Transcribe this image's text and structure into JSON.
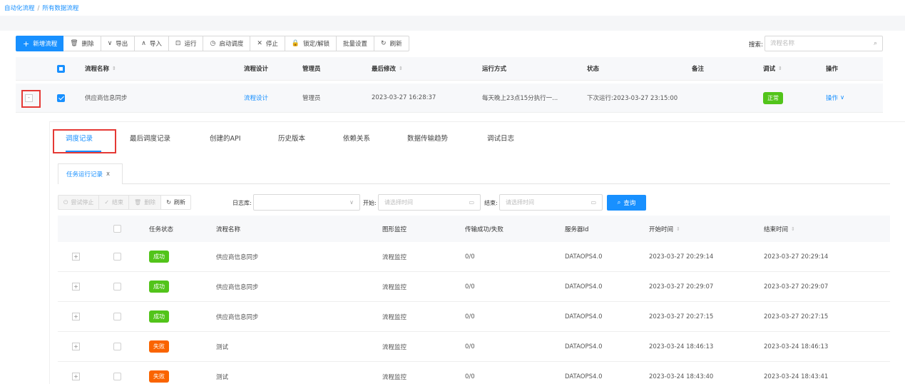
{
  "breadcrumb": {
    "root": "自动化流程",
    "separator": "/",
    "current": "所有数据流程"
  },
  "toolbar": {
    "new_flow": "新增流程",
    "delete": "删除",
    "export": "导出",
    "import": "导入",
    "run": "运行",
    "start_schedule": "启动调度",
    "stop": "停止",
    "lock_unlock": "锁定/解锁",
    "batch_settings": "批量设置",
    "refresh": "刷新"
  },
  "search": {
    "label": "搜索:",
    "placeholder": "流程名称"
  },
  "flow_table": {
    "headers": {
      "name": "流程名称",
      "design": "流程设计",
      "admin": "管理员",
      "last_modified": "最后修改",
      "run_mode": "运行方式",
      "status": "状态",
      "note": "备注",
      "debug": "调试",
      "action": "操作"
    },
    "row": {
      "name": "供应商信息同步",
      "design": "流程设计",
      "admin": "管理员",
      "last_modified": "2023-03-27 16:28:37",
      "run_mode": "每天晚上23点15分执行一...",
      "status": "下次运行:2023-03-27 23:15:00",
      "debug": "正常",
      "action": "操作"
    }
  },
  "detail_tabs": [
    "调度记录",
    "最后调度记录",
    "创建的API",
    "历史版本",
    "依赖关系",
    "数据传输趋势",
    "调试日志"
  ],
  "subtab": {
    "label": "任务运行记录",
    "close": "x"
  },
  "sub_toolbar": {
    "try_stop": "尝试停止",
    "finish": "结束",
    "delete": "删除",
    "refresh": "刷新"
  },
  "filters": {
    "log_label": "日志库:",
    "start_label": "开始:",
    "start_placeholder": "请选择时间",
    "end_label": "结束:",
    "end_placeholder": "请选择时间",
    "query": "查询"
  },
  "task_table": {
    "headers": {
      "status": "任务状态",
      "name": "流程名称",
      "monitor": "图形监控",
      "transfer": "传输成功/失败",
      "server": "服务器Id",
      "start": "开始时间",
      "end": "结束时间"
    },
    "rows": [
      {
        "status": "成功",
        "status_type": "ok",
        "name": "供应商信息同步",
        "monitor": "流程监控",
        "transfer": "0/0",
        "server": "DATAOPS4.0",
        "start": "2023-03-27 20:29:14",
        "end": "2023-03-27 20:29:14"
      },
      {
        "status": "成功",
        "status_type": "ok",
        "name": "供应商信息同步",
        "monitor": "流程监控",
        "transfer": "0/0",
        "server": "DATAOPS4.0",
        "start": "2023-03-27 20:29:07",
        "end": "2023-03-27 20:29:07"
      },
      {
        "status": "成功",
        "status_type": "ok",
        "name": "供应商信息同步",
        "monitor": "流程监控",
        "transfer": "0/0",
        "server": "DATAOPS4.0",
        "start": "2023-03-27 20:27:15",
        "end": "2023-03-27 20:27:15"
      },
      {
        "status": "失败",
        "status_type": "fail",
        "name": "测试",
        "monitor": "流程监控",
        "transfer": "0/0",
        "server": "DATAOPS4.0",
        "start": "2023-03-24 18:46:13",
        "end": "2023-03-24 18:46:13"
      },
      {
        "status": "失败",
        "status_type": "fail",
        "name": "测试",
        "monitor": "流程监控",
        "transfer": "0/0",
        "server": "DATAOPS4.0",
        "start": "2023-03-24 18:43:40",
        "end": "2023-03-24 18:43:41"
      }
    ]
  },
  "colors": {
    "primary": "#1890ff",
    "success": "#52c41a",
    "fail": "#fa6400",
    "highlight": "#e53935"
  }
}
